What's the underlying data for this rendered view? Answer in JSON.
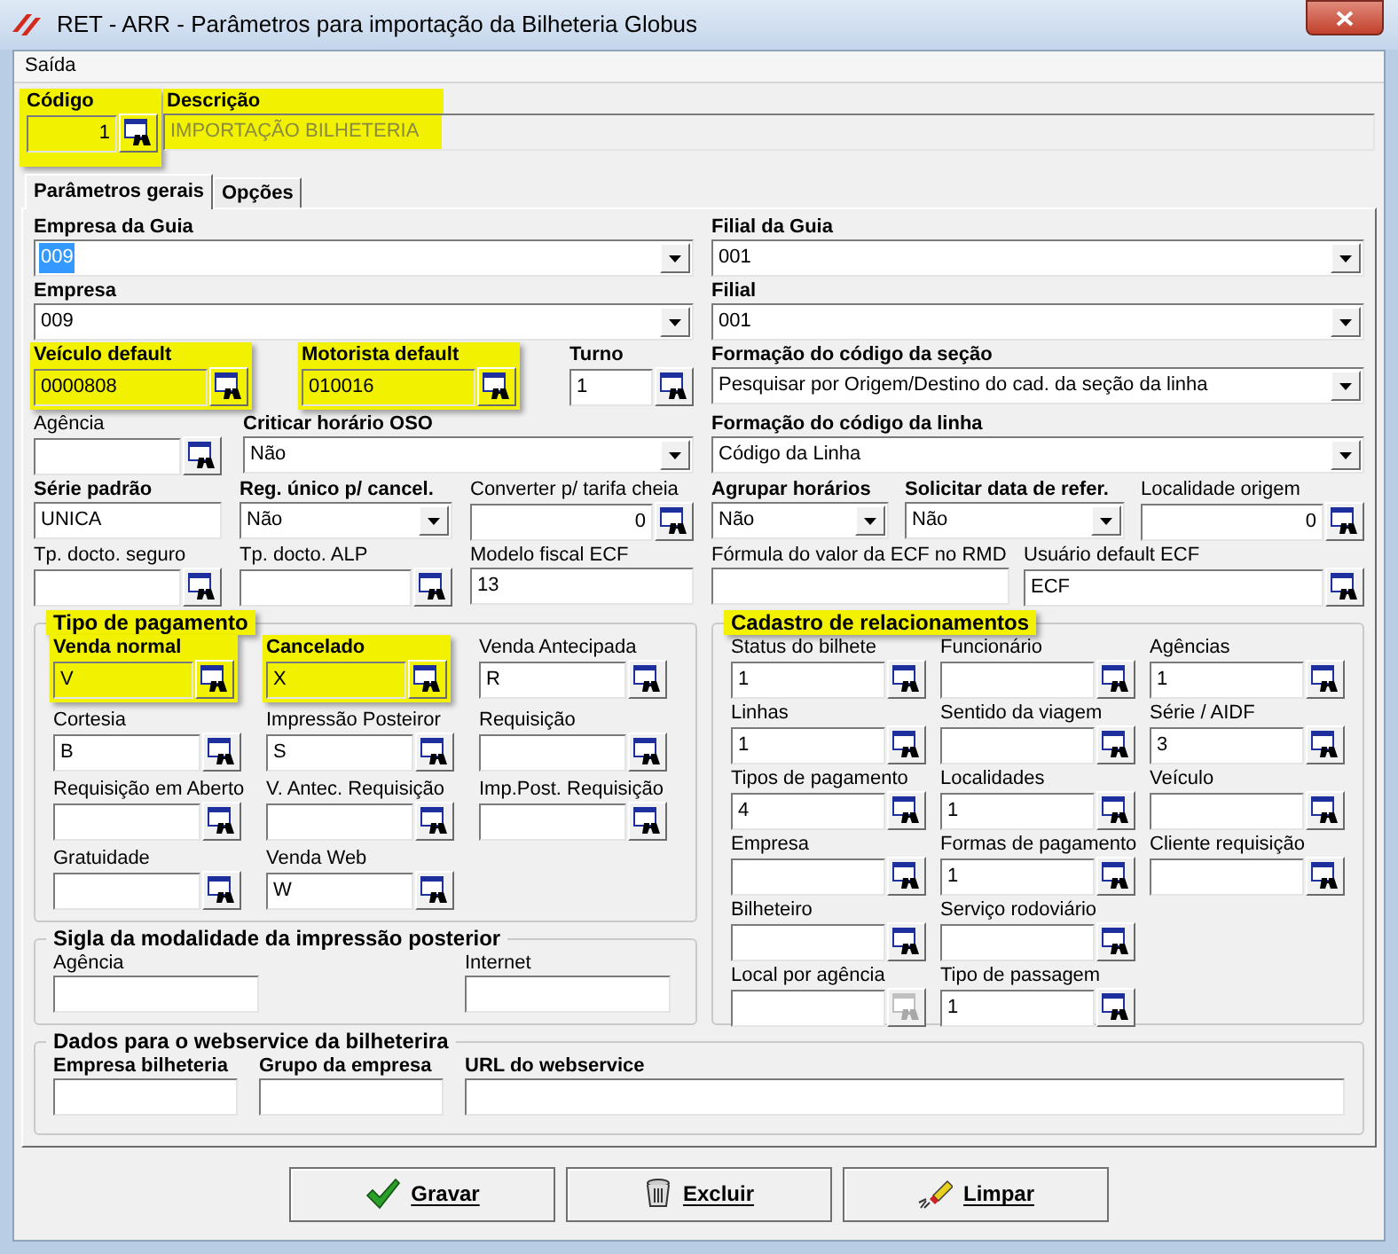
{
  "window": {
    "title": "RET - ARR - Parâmetros para importação da Bilheteria Globus"
  },
  "menu": [
    {
      "label": "Saída"
    }
  ],
  "header": {
    "highlighted": true,
    "code": {
      "kind": "number_lookup",
      "label": "Código",
      "bold": true,
      "highlighted": true,
      "value": "1"
    },
    "description": {
      "label": "Descrição",
      "value": "IMPORTAÇÃO BILHETERIA"
    }
  },
  "tabs": [
    {
      "label": "Parâmetros gerais",
      "selected": true
    },
    {
      "label": "Opções",
      "selected": false
    }
  ],
  "rows": [
    {
      "left": [
        {
          "kind": "combo",
          "label": "Empresa da Guia",
          "bold": true,
          "highlighted": false,
          "value": "009",
          "text_selected": true
        }
      ],
      "right": [
        {
          "kind": "combo",
          "label": "Filial da Guia",
          "bold": true,
          "highlighted": false,
          "value": "001",
          "text_selected": false
        }
      ]
    },
    {
      "left": [
        {
          "kind": "combo",
          "label": "Empresa",
          "bold": true,
          "highlighted": false,
          "value": "009",
          "text_selected": false
        }
      ],
      "right": [
        {
          "kind": "combo",
          "label": "Filial",
          "bold": true,
          "highlighted": false,
          "value": "001",
          "text_selected": false
        }
      ]
    },
    {
      "left": [
        {
          "kind": "lookup",
          "label": "Veículo default",
          "bold": true,
          "highlighted": true,
          "value": "0000808"
        },
        {
          "kind": "lookup",
          "label": "Motorista default",
          "bold": true,
          "highlighted": true,
          "value": "010016"
        },
        {
          "kind": "lookup",
          "label": "Turno",
          "bold": true,
          "highlighted": false,
          "value": "1"
        }
      ],
      "right": [
        {
          "kind": "combo",
          "label": "Formação do código da seção",
          "bold": true,
          "highlighted": false,
          "value": "Pesquisar por Origem/Destino do cad. da seção da linha",
          "text_selected": false
        }
      ]
    },
    {
      "left": [
        {
          "kind": "lookup",
          "label": "Agência",
          "bold": false,
          "highlighted": false
        },
        {
          "kind": "combo",
          "label": "Criticar horário OSO",
          "bold": true,
          "highlighted": false,
          "value": "Não",
          "text_selected": false
        }
      ],
      "right": [
        {
          "kind": "combo",
          "label": "Formação do código da linha",
          "bold": true,
          "highlighted": false,
          "value": "Código da Linha",
          "text_selected": false
        }
      ]
    },
    {
      "left": [
        {
          "kind": "text",
          "label": "Série  padrão",
          "bold": true,
          "highlighted": false,
          "value": "UNICA"
        },
        {
          "kind": "combo",
          "label": "Reg. único p/ cancel.",
          "bold": true,
          "highlighted": false,
          "value": "Não",
          "text_selected": false
        },
        {
          "kind": "number_lookup",
          "label": "Converter p/ tarifa cheia",
          "bold": false,
          "highlighted": false,
          "value": "0"
        }
      ],
      "right": [
        {
          "kind": "combo",
          "label": "Agrupar horários",
          "bold": true,
          "highlighted": false,
          "value": "Não",
          "text_selected": false
        },
        {
          "kind": "combo",
          "label": "Solicitar data de refer.",
          "bold": true,
          "highlighted": false,
          "value": "Não",
          "text_selected": false
        },
        {
          "kind": "number_lookup",
          "label": "Localidade origem",
          "bold": false,
          "highlighted": false,
          "value": "0"
        }
      ]
    },
    {
      "left": [
        {
          "kind": "lookup",
          "label": "Tp. docto. seguro",
          "bold": false,
          "highlighted": false
        },
        {
          "kind": "lookup",
          "label": "Tp. docto. ALP",
          "bold": false,
          "highlighted": false
        },
        {
          "kind": "text",
          "label": "Modelo fiscal ECF",
          "bold": false,
          "highlighted": false,
          "value": "13"
        }
      ],
      "right": [
        {
          "kind": "text",
          "label": "Fórmula do valor da ECF no RMD",
          "bold": false,
          "highlighted": false
        },
        {
          "kind": "lookup",
          "label": "Usuário default ECF",
          "bold": false,
          "highlighted": false,
          "value": "ECF"
        }
      ]
    }
  ],
  "payment_group": {
    "title": "Tipo de pagamento",
    "highlighted": true,
    "fields": [
      {
        "kind": "lookup",
        "label": "Venda normal",
        "bold": true,
        "highlighted": true,
        "value": "V"
      },
      {
        "kind": "lookup",
        "label": "Cancelado",
        "bold": true,
        "highlighted": true,
        "value": "X"
      },
      {
        "kind": "lookup",
        "label": "Venda Antecipada",
        "bold": false,
        "highlighted": false,
        "value": "R"
      },
      {
        "kind": "lookup",
        "label": "Cortesia",
        "bold": false,
        "highlighted": false,
        "value": "B"
      },
      {
        "kind": "lookup",
        "label": "Impressão Posteiror",
        "bold": false,
        "highlighted": false,
        "value": "S"
      },
      {
        "kind": "lookup",
        "label": "Requisição",
        "bold": false,
        "highlighted": false
      },
      {
        "kind": "lookup",
        "label": "Requisição em Aberto",
        "bold": false,
        "highlighted": false
      },
      {
        "kind": "lookup",
        "label": "V. Antec. Requisição",
        "bold": false,
        "highlighted": false
      },
      {
        "kind": "lookup",
        "label": "Imp.Post. Requisição",
        "bold": false,
        "highlighted": false
      },
      {
        "kind": "lookup",
        "label": "Gratuidade",
        "bold": false,
        "highlighted": false
      },
      {
        "kind": "lookup",
        "label": "Venda Web",
        "bold": false,
        "highlighted": false,
        "value": "W"
      }
    ]
  },
  "sigla_group": {
    "title": "Sigla da modalidade da impressão posterior",
    "fields": [
      {
        "kind": "text",
        "label": "Agência"
      },
      {
        "kind": "text",
        "label": "Internet"
      }
    ]
  },
  "relations_group": {
    "title": "Cadastro de relacionamentos",
    "highlighted": true,
    "columns": [
      [
        {
          "kind": "lookup",
          "label": "Status do bilhete",
          "value": "1",
          "disabled": false
        },
        {
          "kind": "lookup",
          "label": "Linhas",
          "value": "1",
          "disabled": false
        },
        {
          "kind": "lookup",
          "label": "Tipos de pagamento",
          "value": "4",
          "disabled": false
        },
        {
          "kind": "lookup",
          "label": "Empresa",
          "disabled": false
        },
        {
          "kind": "lookup",
          "label": "Bilheteiro",
          "disabled": false
        },
        {
          "kind": "lookup",
          "label": "Local por agência",
          "disabled": true
        }
      ],
      [
        {
          "kind": "lookup",
          "label": "Funcionário",
          "disabled": false
        },
        {
          "kind": "lookup",
          "label": "Sentido da viagem",
          "disabled": false
        },
        {
          "kind": "lookup",
          "label": "Localidades",
          "value": "1",
          "disabled": false
        },
        {
          "kind": "lookup",
          "label": "Formas de pagamento",
          "value": "1",
          "disabled": false
        },
        {
          "kind": "lookup",
          "label": "Serviço rodoviário",
          "disabled": false
        },
        {
          "kind": "lookup",
          "label": "Tipo de passagem",
          "value": "1",
          "disabled": false
        }
      ],
      [
        {
          "kind": "lookup",
          "label": "Agências",
          "value": "1",
          "disabled": false
        },
        {
          "kind": "lookup",
          "label": "Série / AIDF",
          "value": "3",
          "disabled": false
        },
        {
          "kind": "lookup",
          "label": "Veículo",
          "disabled": false
        },
        {
          "kind": "lookup",
          "label": "Cliente requisição",
          "disabled": false
        }
      ]
    ]
  },
  "webservice_group": {
    "title": "Dados para o webservice da bilheterira",
    "fields": [
      {
        "kind": "text",
        "label": "Empresa bilheteria",
        "bold": true
      },
      {
        "kind": "text",
        "label": "Grupo da empresa",
        "bold": true
      },
      {
        "kind": "text",
        "label": "URL do webservice",
        "bold": true
      }
    ]
  },
  "buttons": [
    {
      "label": "Gravar",
      "kind": "save"
    },
    {
      "label": "Excluir",
      "kind": "delete"
    },
    {
      "label": "Limpar",
      "kind": "clear"
    }
  ]
}
